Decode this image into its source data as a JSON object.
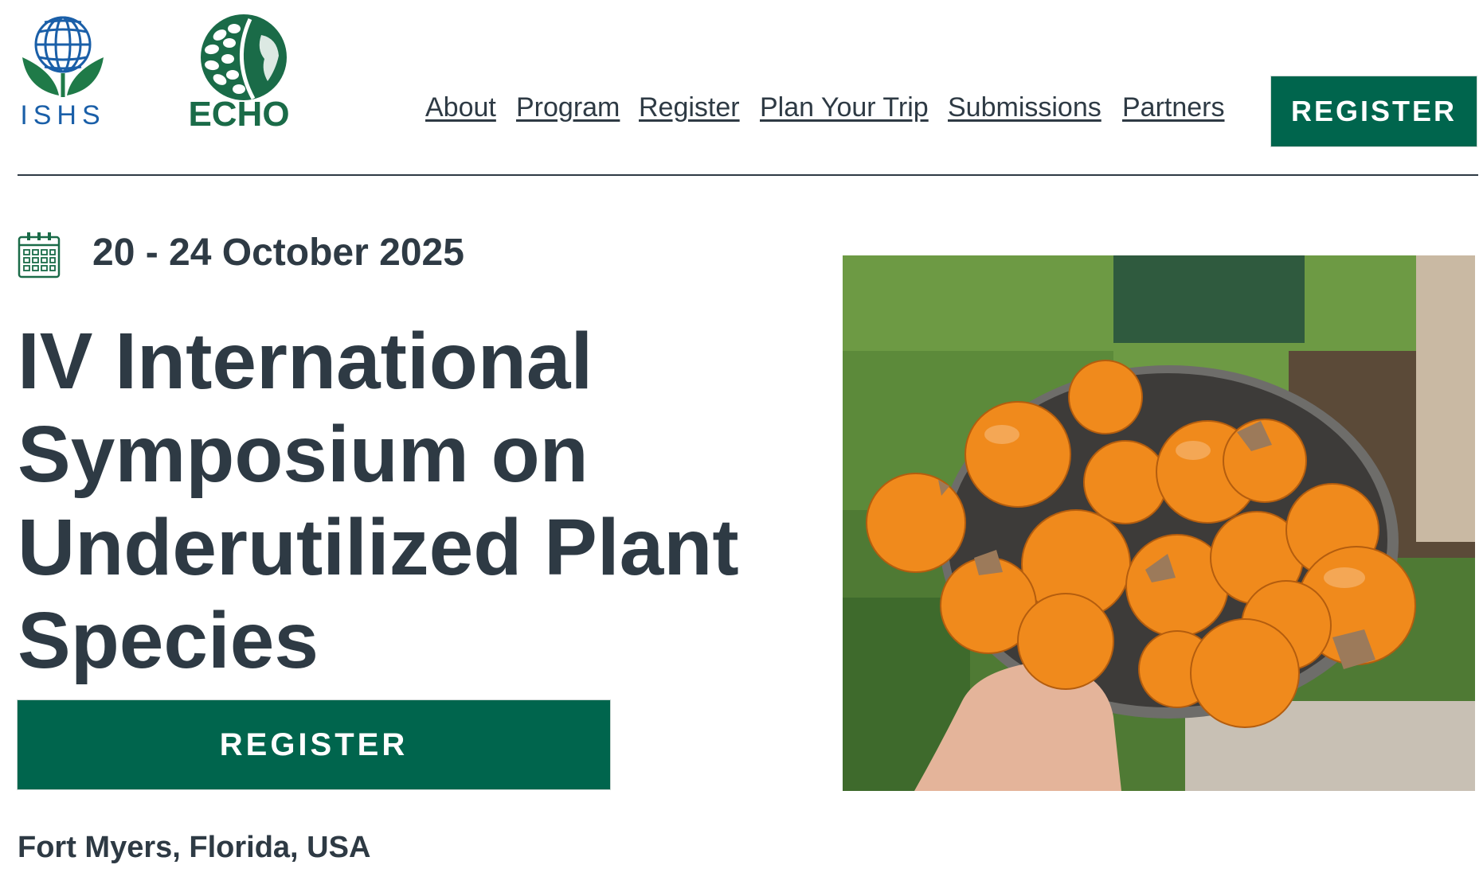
{
  "header": {
    "logos": {
      "ishs": {
        "text": "ISHS",
        "icon": "globe-flower-logo",
        "color": "#1a5fa8",
        "leaf_color": "#1f7a48"
      },
      "echo": {
        "text": "ECHO",
        "icon": "globe-leaf-logo",
        "color": "#1a6b48"
      }
    },
    "nav": [
      {
        "label": "About"
      },
      {
        "label": "Program"
      },
      {
        "label": "Register"
      },
      {
        "label": "Plan Your Trip"
      },
      {
        "label": "Submissions"
      },
      {
        "label": "Partners"
      }
    ],
    "register_button": "REGISTER"
  },
  "hero": {
    "calendar_icon": "calendar-icon",
    "date": "20 - 24 October 2025",
    "title": "IV International Symposium on Underutilized Plant Species",
    "register_button": "REGISTER",
    "location": "Fort Myers, Florida, USA",
    "photo": {
      "icon": "orange-fruit-bowl-photo"
    }
  },
  "colors": {
    "brand_green": "#00654d",
    "text": "#2e3a44",
    "fruit": "#f08a1c"
  }
}
